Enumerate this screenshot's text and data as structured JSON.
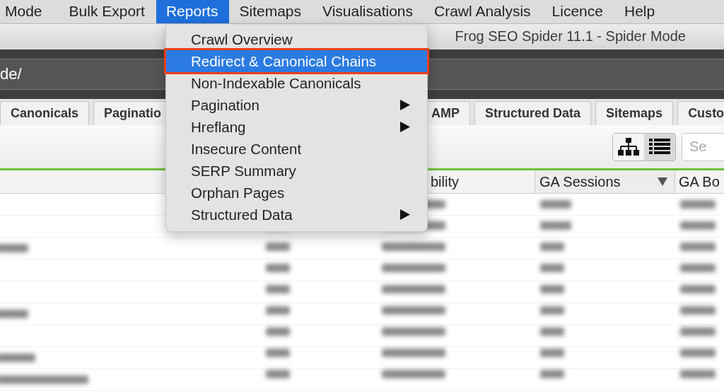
{
  "menu_bar": [
    {
      "label": "Mode",
      "selected": false
    },
    {
      "label": "Bulk Export",
      "selected": false
    },
    {
      "label": "Reports",
      "selected": true
    },
    {
      "label": "Sitemaps",
      "selected": false
    },
    {
      "label": "Visualisations",
      "selected": false
    },
    {
      "label": "Crawl Analysis",
      "selected": false
    },
    {
      "label": "Licence",
      "selected": false
    },
    {
      "label": "Help",
      "selected": false
    }
  ],
  "window": {
    "title": "Frog SEO Spider 11.1 - Spider Mode"
  },
  "url_field": {
    "value": "de/"
  },
  "tabs_left": [
    {
      "label": "Canonicals",
      "selected": false
    },
    {
      "label": "Paginatio",
      "selected": false
    }
  ],
  "tabs_right": [
    {
      "label": "AMP",
      "selected": false
    },
    {
      "label": "Structured Data",
      "selected": false
    },
    {
      "label": "Sitemaps",
      "selected": false
    },
    {
      "label": "Custo",
      "selected": false
    }
  ],
  "view_toggle": [
    {
      "kind": "tree",
      "selected": false
    },
    {
      "kind": "list",
      "selected": true
    }
  ],
  "search": {
    "placeholder": "Se"
  },
  "table": {
    "columns": [
      {
        "label": "bility",
        "sorted": false
      },
      {
        "label": "GA Sessions",
        "sorted": true
      },
      {
        "label": "GA Bo",
        "sorted": false
      }
    ]
  },
  "reports_menu": {
    "items": [
      {
        "label": "Crawl Overview",
        "selected": false,
        "submenu": false
      },
      {
        "label": "Redirect & Canonical Chains",
        "selected": true,
        "submenu": false
      },
      {
        "label": "Non-Indexable Canonicals",
        "selected": false,
        "submenu": false
      },
      {
        "label": "Pagination",
        "selected": false,
        "submenu": true
      },
      {
        "label": "Hreflang",
        "selected": false,
        "submenu": true
      },
      {
        "label": "Insecure Content",
        "selected": false,
        "submenu": false
      },
      {
        "label": "SERP Summary",
        "selected": false,
        "submenu": false
      },
      {
        "label": "Orphan Pages",
        "selected": false,
        "submenu": false
      },
      {
        "label": "Structured Data",
        "selected": false,
        "submenu": true
      }
    ]
  }
}
